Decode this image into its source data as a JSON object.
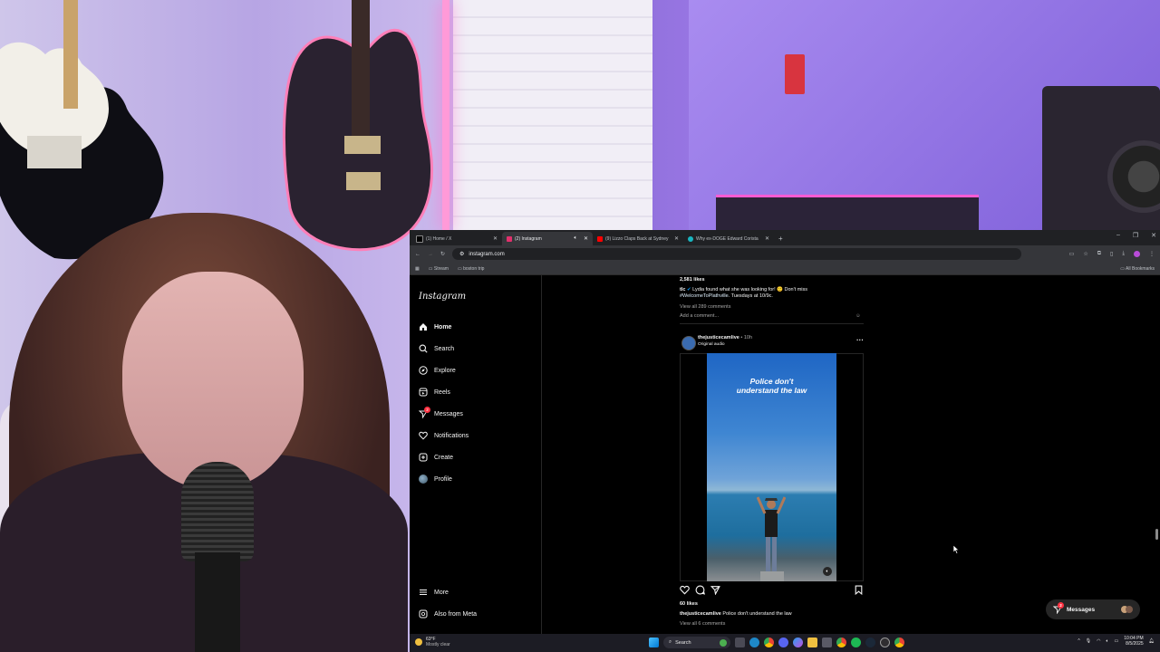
{
  "browser": {
    "tabs": [
      {
        "label": "(1) Home / X",
        "fav_color": "#000000"
      },
      {
        "label": "(2) Instagram",
        "fav_color": "#e1306c"
      },
      {
        "label": "(9) Lizzo Claps Back at Sydney",
        "fav_color": "#ff0000"
      },
      {
        "label": "Why ex-DOGE Edward Corista",
        "fav_color": "#19b5c0"
      }
    ],
    "url": "instagram.com",
    "bookmarks": [
      "Stream",
      "boston trip"
    ],
    "all_bookmarks": "All Bookmarks"
  },
  "instagram": {
    "logo": "Instagram",
    "nav": {
      "home": "Home",
      "search": "Search",
      "explore": "Explore",
      "reels": "Reels",
      "messages": "Messages",
      "messages_badge": "2",
      "notifications": "Notifications",
      "create": "Create",
      "profile": "Profile",
      "more": "More",
      "also_from_meta": "Also from Meta"
    },
    "prev_post": {
      "likes": "2,581 likes",
      "caption_user": "tlc",
      "caption_text": "Lydia found what she was looking for! 🙂 Don't miss",
      "caption_hashtag": "#WelcomeToPlathville",
      "caption_tail": ". Tuesdays at 10/9c.",
      "view_comments": "View all 289 comments",
      "add_comment": "Add a comment..."
    },
    "post": {
      "username": "thejusticecamlive",
      "time": "• 10h",
      "audio": "Original audio",
      "video_text_line1": "Police don't",
      "video_text_line2": "understand the law",
      "likes": "60 likes",
      "caption_user": "thejusticecamlive",
      "caption_text": "Police don't understand the law",
      "view_comments": "View all 6 comments"
    },
    "messages_pill": "Messages",
    "messages_pill_badge": "2"
  },
  "taskbar": {
    "temp": "63°F",
    "weather": "Mostly clear",
    "search_placeholder": "Search",
    "time": "10:04 PM",
    "date": "8/5/2025"
  }
}
